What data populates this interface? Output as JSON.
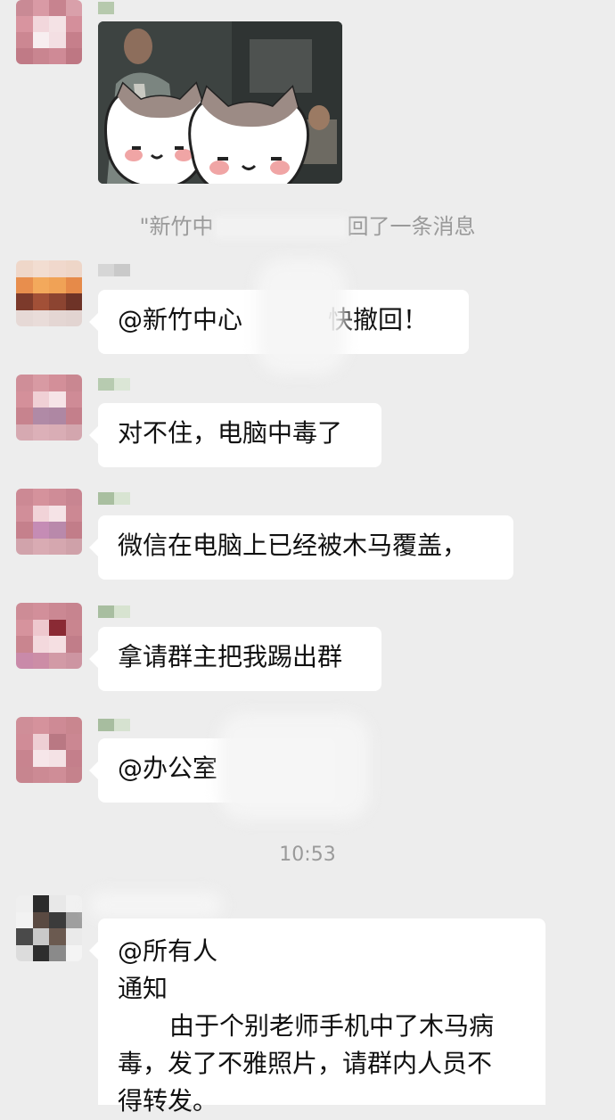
{
  "chat": {
    "image_message": {
      "recall_notice_prefix": "\"新竹中",
      "recall_notice_suffix": "回了一条消息"
    },
    "messages": [
      {
        "text": "@新竹中心",
        "text_tail": "快撤回！"
      },
      {
        "text": "对不住，电脑中毒了"
      },
      {
        "text": "微信在电脑上已经被木马覆盖，"
      },
      {
        "text": "拿请群主把我踢出群"
      },
      {
        "text": "@办公室"
      }
    ],
    "timestamp": "10:53",
    "announcement": {
      "mention": "@所有人",
      "heading": "通知",
      "body_line1": "由于个别老师手机中了木马病",
      "body_line2": "毒，发了不雅照片，请群内人员不",
      "body_line3": "得转发。"
    }
  },
  "colors": {
    "background": "#ededed",
    "bubble": "#ffffff",
    "system_text": "#9a9a9a"
  },
  "icons": [
    "cat-sticker-icon"
  ]
}
